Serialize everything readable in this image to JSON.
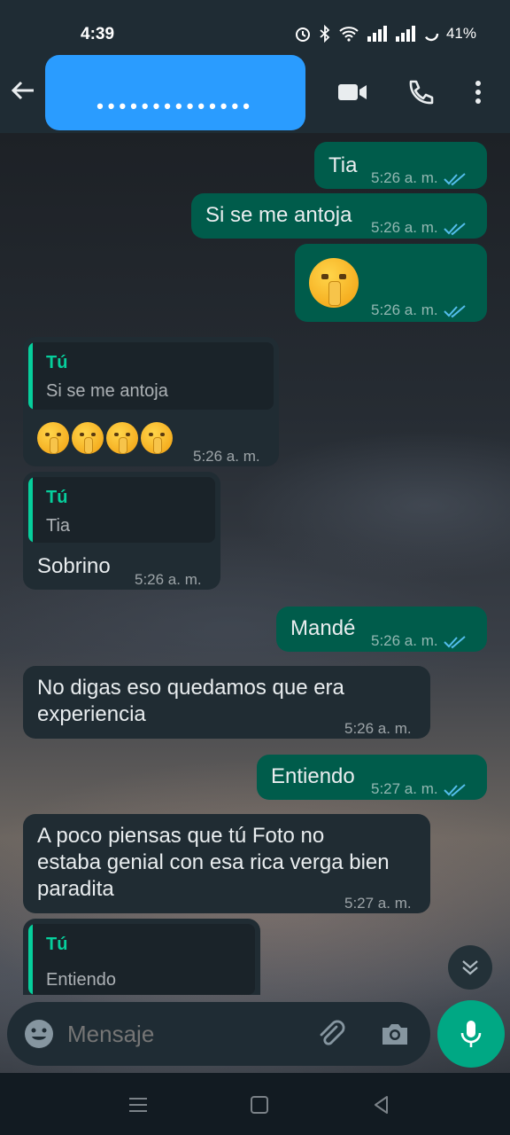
{
  "status": {
    "time": "4:39",
    "battery": "41%"
  },
  "header": {
    "contact_name_masked": "••••••••••••••",
    "colors": {
      "accent": "#00a884",
      "outgoing": "#005c4b",
      "incoming": "#202c33",
      "highlight": "#2a9cff"
    }
  },
  "messages": [
    {
      "dir": "out",
      "text": "Tia",
      "time": "5:26 a. m."
    },
    {
      "dir": "out",
      "text": "Si se me antoja",
      "time": "5:26 a. m."
    },
    {
      "dir": "out",
      "text": "",
      "emoji": "shushing-face",
      "time": "5:26 a. m."
    },
    {
      "dir": "in",
      "reply_author": "Tú",
      "reply_text": "Si se me antoja",
      "emoji_count": 4,
      "time": "5:26 a. m."
    },
    {
      "dir": "in",
      "reply_author": "Tú",
      "reply_text": "Tia",
      "text": "Sobrino",
      "time": "5:26 a. m."
    },
    {
      "dir": "out",
      "text": "Mandé",
      "time": "5:26 a. m."
    },
    {
      "dir": "in",
      "text_line1": "No digas eso quedamos que era",
      "text_line2": "experiencia",
      "time": "5:26 a. m."
    },
    {
      "dir": "out",
      "text": "Entiendo",
      "time": "5:27 a. m."
    },
    {
      "dir": "in",
      "text_line1": "A poco piensas que tú Foto no",
      "text_line2": "estaba genial con esa rica verga bien",
      "text_line3": "paradita",
      "time": "5:27 a. m."
    },
    {
      "dir": "in",
      "reply_author": "Tú",
      "reply_text": "Entiendo"
    }
  ],
  "composer": {
    "placeholder": "Mensaje"
  }
}
